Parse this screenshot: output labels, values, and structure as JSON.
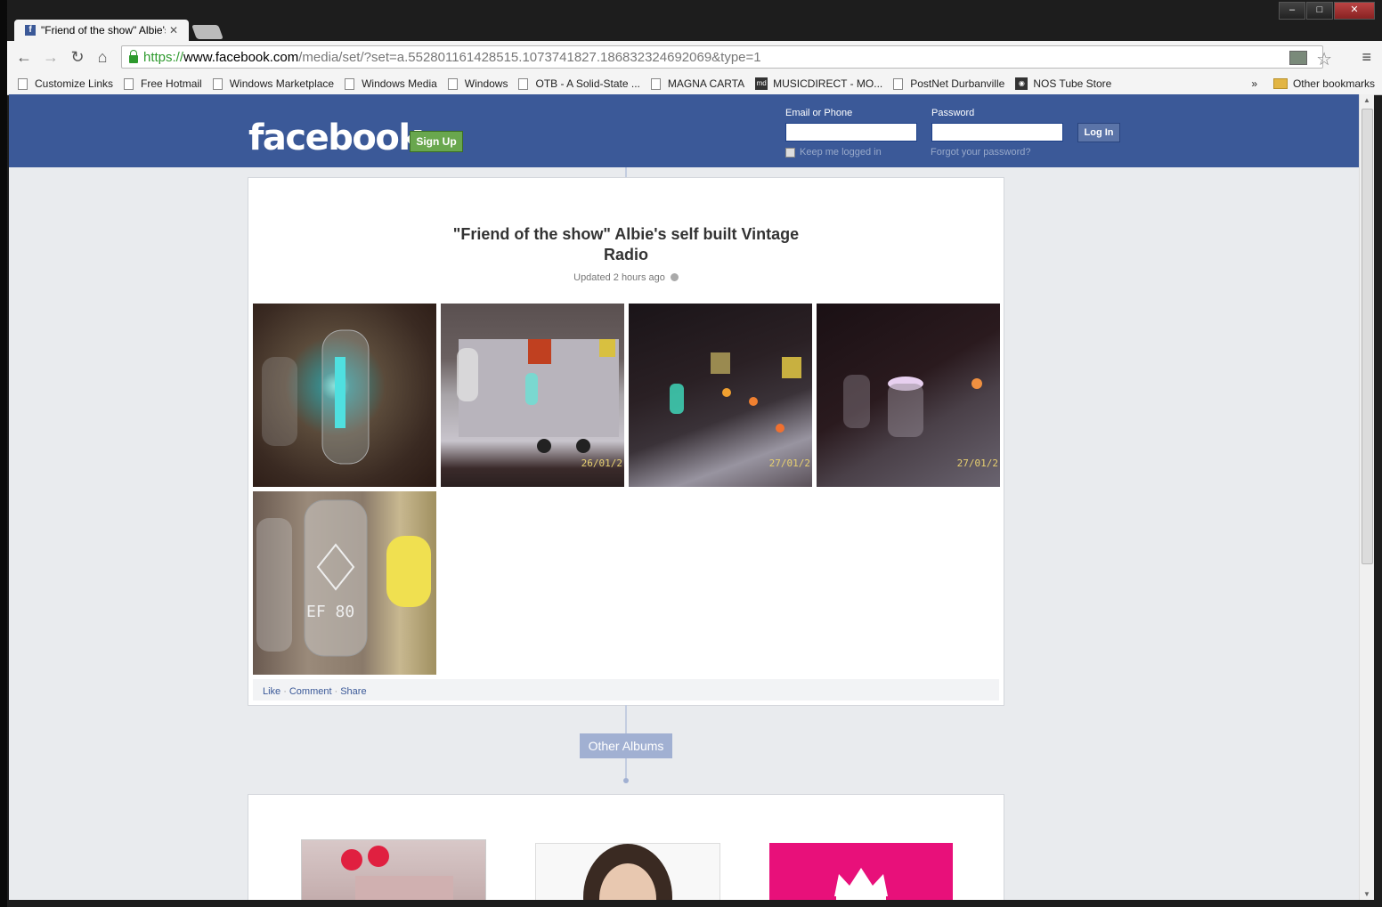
{
  "window": {
    "tab_title": "\"Friend of the show\" Albie's self built Vintage Radio",
    "tab_favicon": "facebook-f",
    "controls": {
      "minimize": "–",
      "maximize": "□",
      "close": "✕"
    }
  },
  "toolbar": {
    "url_scheme": "https://",
    "url_host": "www.facebook.com",
    "url_path": "/media/set/?set=a.552801161428515.1073741827.186832324692069&type=1"
  },
  "bookmarks": {
    "items": [
      {
        "label": "Customize Links",
        "icon": "page"
      },
      {
        "label": "Free Hotmail",
        "icon": "page"
      },
      {
        "label": "Windows Marketplace",
        "icon": "page"
      },
      {
        "label": "Windows Media",
        "icon": "page"
      },
      {
        "label": "Windows",
        "icon": "page"
      },
      {
        "label": "OTB - A Solid-State ...",
        "icon": "page"
      },
      {
        "label": "MAGNA CARTA",
        "icon": "page"
      },
      {
        "label": "MUSICDIRECT - MO...",
        "icon": "site"
      },
      {
        "label": "PostNet Durbanville",
        "icon": "page"
      },
      {
        "label": "NOS Tube Store",
        "icon": "site"
      }
    ],
    "more": "»",
    "other": "Other bookmarks"
  },
  "fb": {
    "logo": "facebook",
    "signup": "Sign Up",
    "email_label": "Email or Phone",
    "password_label": "Password",
    "keep_logged_in": "Keep me logged in",
    "forgot": "Forgot your password?",
    "login": "Log In"
  },
  "album": {
    "title_line1": "\"Friend of the show\" Albie's self built Vintage",
    "title_line2": "Radio",
    "updated": "Updated 2 hours ago",
    "photos": [
      {
        "datestamp": ""
      },
      {
        "datestamp": "26/01/2"
      },
      {
        "datestamp": "27/01/2"
      },
      {
        "datestamp": "27/01/2"
      },
      {
        "datestamp": "EF 80"
      }
    ],
    "actions": {
      "like": "Like",
      "comment": "Comment",
      "share": "Share",
      "sep": "·"
    }
  },
  "other_albums": {
    "label": "Other Albums"
  },
  "colors": {
    "fb_blue": "#3b5998",
    "signup_green": "#69a74e",
    "page_bg": "#e9ebee"
  }
}
